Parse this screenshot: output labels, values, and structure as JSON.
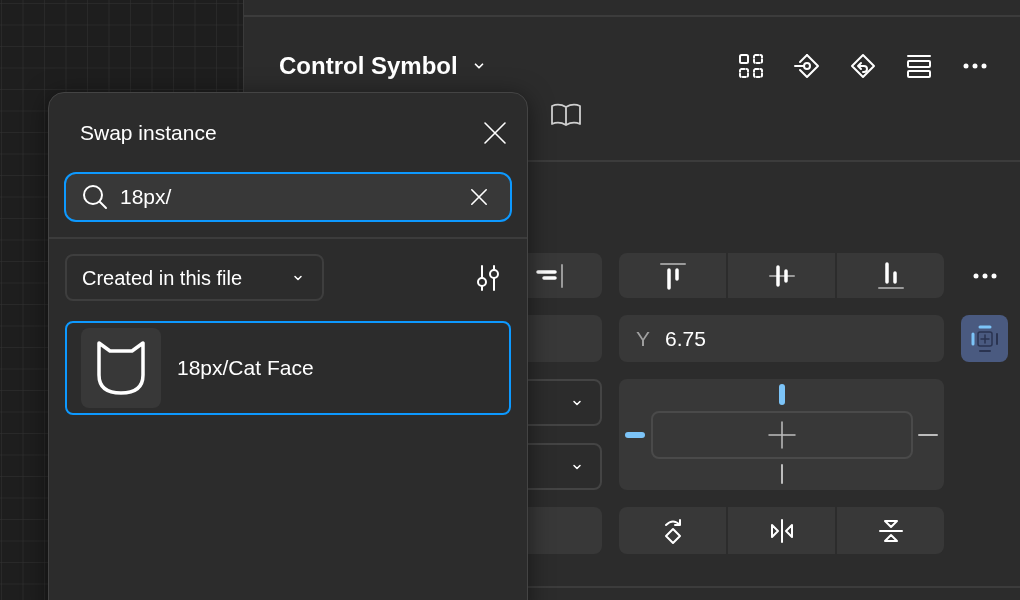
{
  "panel": {
    "title": "Control Symbol",
    "position": {
      "y_label": "Y",
      "y_value": "6.75"
    },
    "constraint_toggle": {
      "selected": true
    },
    "constraints": {
      "top": true,
      "left": true,
      "right": false,
      "bottom": false
    }
  },
  "popup": {
    "title": "Swap instance",
    "search": {
      "value": "18px/"
    },
    "filter": {
      "label": "Created in this file"
    },
    "results": [
      {
        "label": "18px/Cat Face",
        "selected": true
      }
    ]
  }
}
